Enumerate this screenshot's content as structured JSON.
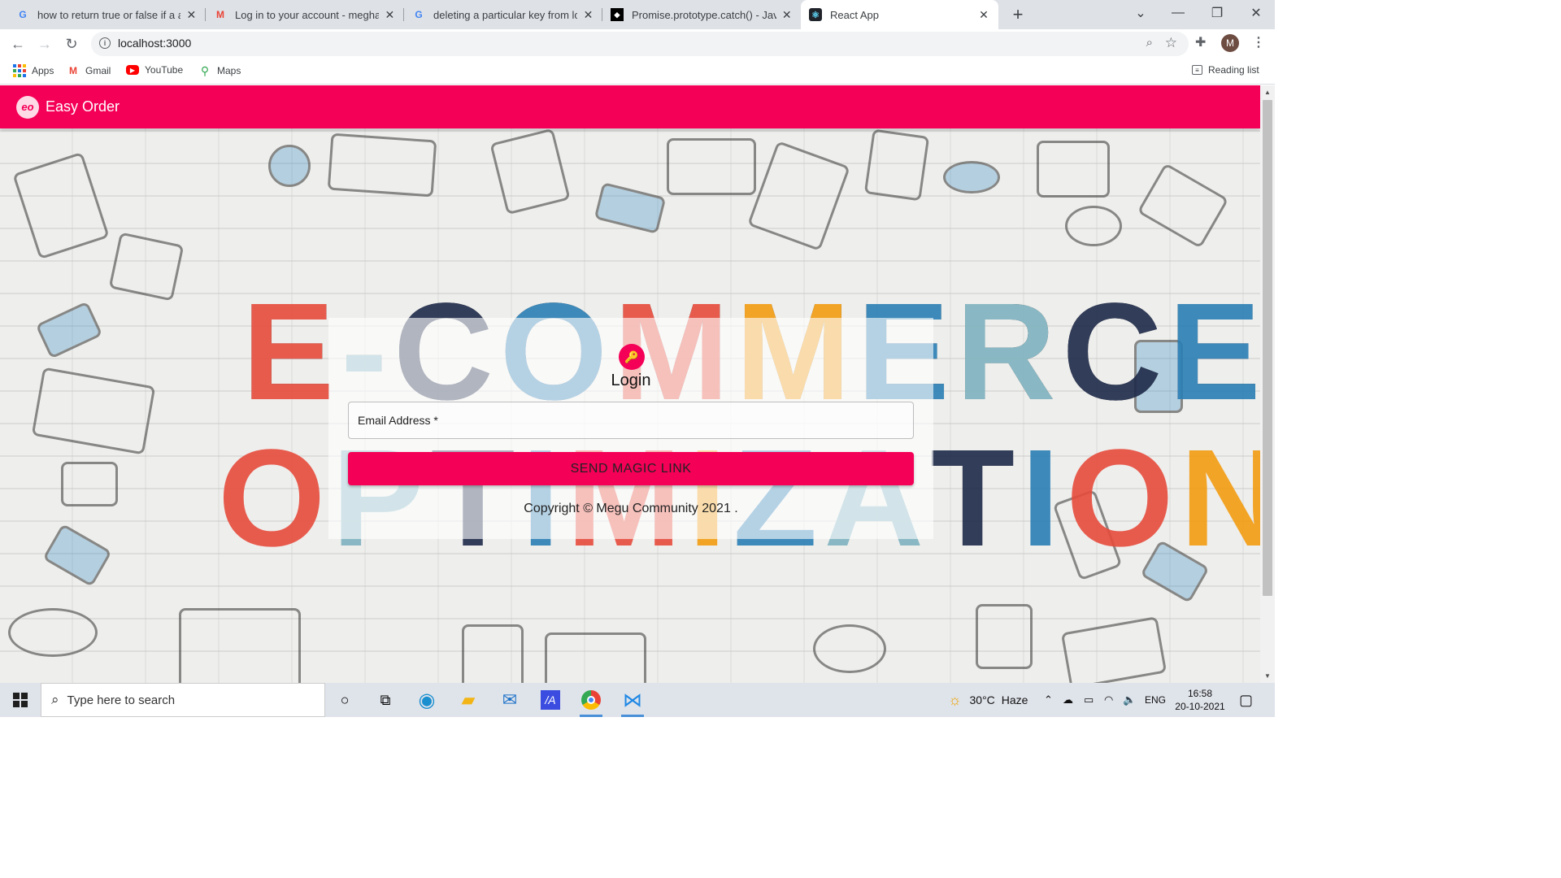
{
  "browser": {
    "tabs": [
      {
        "title": "how to return true or false if a ar",
        "favicon": "google-icon",
        "active": false
      },
      {
        "title": "Log in to your account - meghas",
        "favicon": "gmail-icon",
        "active": false
      },
      {
        "title": "deleting a particular key from loc",
        "favicon": "google-icon",
        "active": false
      },
      {
        "title": "Promise.prototype.catch() - JavaS",
        "favicon": "mdn-icon",
        "active": false
      },
      {
        "title": "React App",
        "favicon": "react-icon",
        "active": true
      }
    ],
    "url": "localhost:3000",
    "profile_initial": "M",
    "bookmarks": [
      {
        "label": "Apps",
        "icon": "apps-grid-icon"
      },
      {
        "label": "Gmail",
        "icon": "gmail-icon"
      },
      {
        "label": "YouTube",
        "icon": "youtube-icon"
      },
      {
        "label": "Maps",
        "icon": "maps-icon"
      }
    ],
    "reading_list": "Reading list"
  },
  "app": {
    "logo_text": "eo",
    "brand": "Easy Order",
    "accent_color": "#f50057",
    "hero_line1": "E-COMMERCE",
    "hero_line2": "OPTIMIZATION",
    "login": {
      "title": "Login",
      "icon": "key-icon",
      "email_label": "Email Address *",
      "button_label": "SEND MAGIC LINK",
      "copyright": "Copyright © Megu Community 2021 ."
    }
  },
  "taskbar": {
    "search_placeholder": "Type here to search",
    "weather_temp": "30°C",
    "weather_desc": "Haze",
    "language": "ENG",
    "time": "16:58",
    "date": "20-10-2021"
  }
}
